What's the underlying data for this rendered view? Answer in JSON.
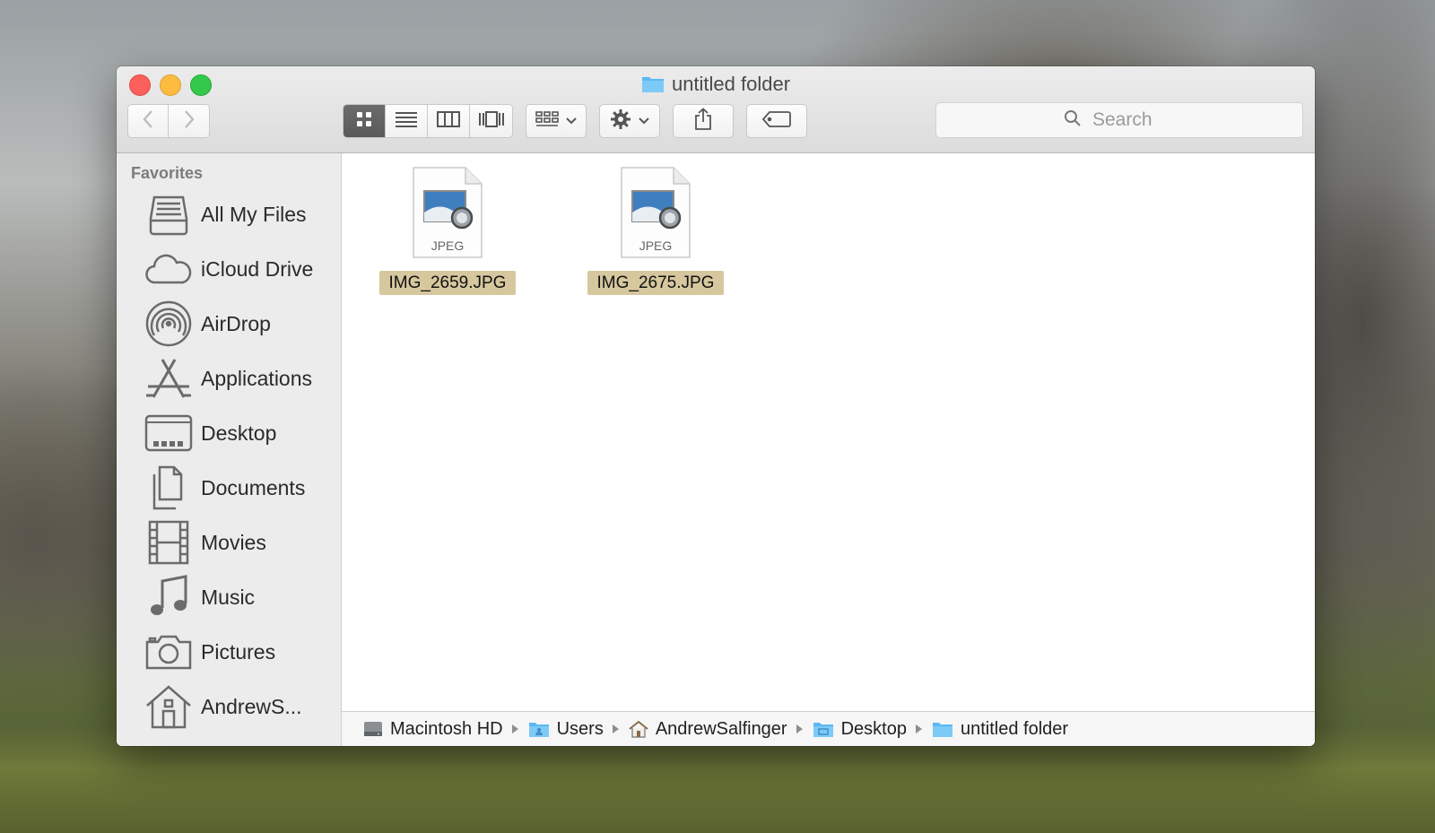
{
  "window": {
    "title": "untitled folder"
  },
  "toolbar": {
    "back": "back",
    "forward": "forward",
    "view_modes": [
      "icon-view",
      "list-view",
      "column-view",
      "cover-flow-view"
    ],
    "arrange": "arrange",
    "action": "action",
    "share": "share",
    "tags": "edit-tags"
  },
  "search": {
    "placeholder": "Search"
  },
  "sidebar": {
    "header": "Favorites",
    "items": [
      {
        "label": "All My Files",
        "icon": "all-my-files-icon"
      },
      {
        "label": "iCloud Drive",
        "icon": "icloud-icon"
      },
      {
        "label": "AirDrop",
        "icon": "airdrop-icon"
      },
      {
        "label": "Applications",
        "icon": "applications-icon"
      },
      {
        "label": "Desktop",
        "icon": "desktop-icon"
      },
      {
        "label": "Documents",
        "icon": "documents-icon"
      },
      {
        "label": "Movies",
        "icon": "movies-icon"
      },
      {
        "label": "Music",
        "icon": "music-icon"
      },
      {
        "label": "Pictures",
        "icon": "pictures-icon"
      },
      {
        "label": "AndrewS...",
        "icon": "home-icon"
      }
    ]
  },
  "files": [
    {
      "name": "IMG_2659.JPG",
      "type": "JPEG"
    },
    {
      "name": "IMG_2675.JPG",
      "type": "JPEG"
    }
  ],
  "pathbar": [
    {
      "label": "Macintosh HD",
      "icon": "hard-drive-icon"
    },
    {
      "label": "Users",
      "icon": "users-folder-icon"
    },
    {
      "label": "AndrewSalfinger",
      "icon": "home-icon"
    },
    {
      "label": "Desktop",
      "icon": "desktop-folder-icon"
    },
    {
      "label": "untitled folder",
      "icon": "folder-icon"
    }
  ],
  "colors": {
    "close": "#fc605c",
    "minimize": "#fdbc40",
    "maximize": "#34c84a",
    "folder_blue": "#5cb9f2",
    "selection": "#d6c79e"
  }
}
